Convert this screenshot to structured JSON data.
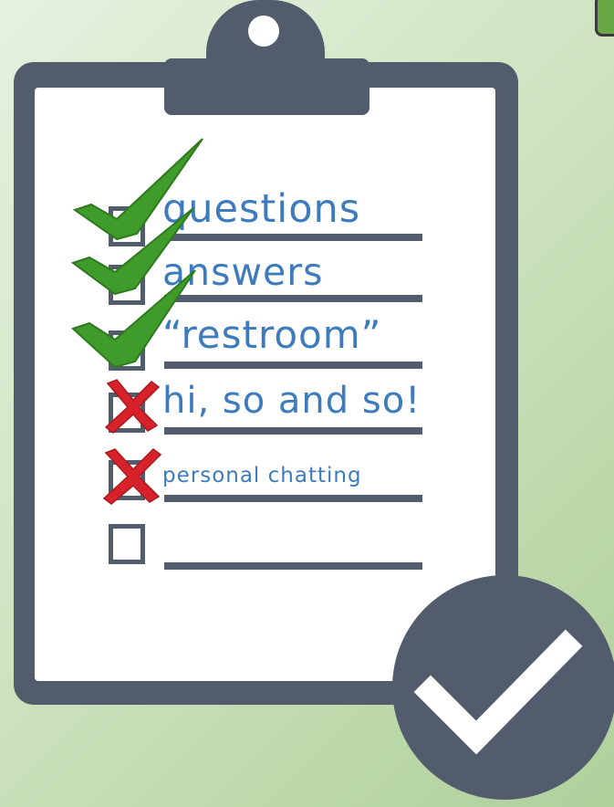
{
  "checklist": {
    "items": [
      {
        "label": "questions",
        "status": "checked",
        "mark_icon": "green-checkmark-icon"
      },
      {
        "label": "answers",
        "status": "checked",
        "mark_icon": "green-checkmark-icon"
      },
      {
        "label": "“restroom”",
        "status": "checked",
        "mark_icon": "green-checkmark-icon"
      },
      {
        "label": "hi, so and so!",
        "status": "crossed",
        "mark_icon": "red-x-icon"
      },
      {
        "label": "personal chatting",
        "status": "crossed",
        "mark_icon": "red-x-icon"
      },
      {
        "label": "",
        "status": "empty",
        "mark_icon": ""
      }
    ]
  },
  "badge": {
    "icon": "checkmark-icon"
  },
  "colors": {
    "board": "#525c6c",
    "paper": "#ffffff",
    "text": "#3d7bbd",
    "check": "#3f9b2a",
    "cross": "#d8222b",
    "background": "#cfe4c1"
  }
}
